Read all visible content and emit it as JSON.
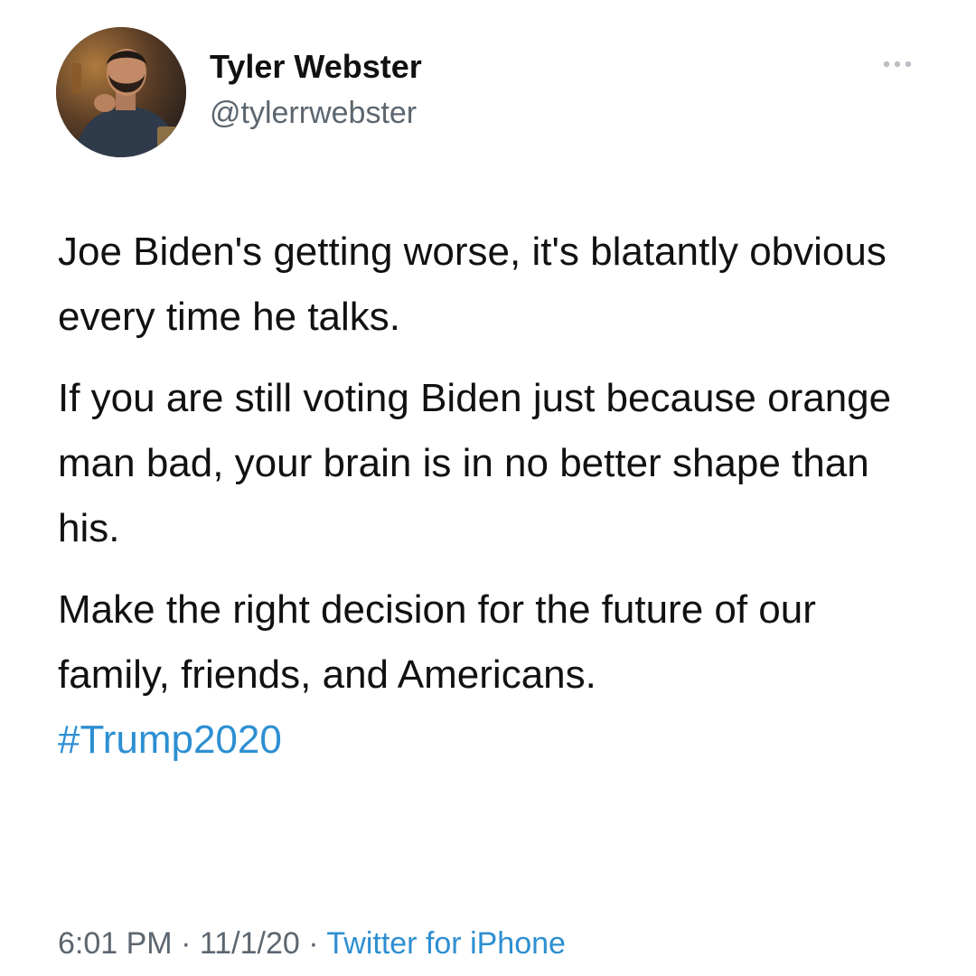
{
  "author": {
    "display_name": "Tyler Webster",
    "handle": "@tylerrwebster",
    "avatar_icon": "profile-photo"
  },
  "more_menu": {
    "icon": "more-dots-icon"
  },
  "tweet": {
    "paragraphs": [
      "Joe Biden's getting worse, it's blatantly obvious every time he talks.",
      "If you are still voting Biden just because orange man bad, your brain is in no better shape than his.",
      "Make the right decision for the future of our family, friends, and Americans."
    ],
    "hashtag": "#Trump2020"
  },
  "meta": {
    "time": "6:01 PM",
    "separator": " · ",
    "date": "11/1/20",
    "source": "Twitter for iPhone"
  },
  "colors": {
    "link": "#2d8fd2",
    "secondary_text": "#5b6670",
    "primary_text": "#111111"
  }
}
